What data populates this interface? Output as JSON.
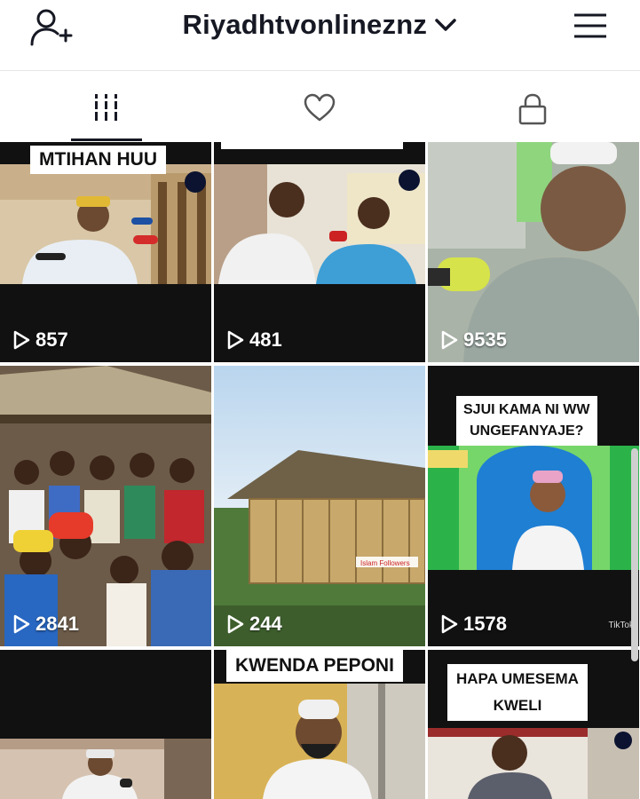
{
  "header": {
    "username": "Riyadhtvonlineznz",
    "add_user_icon": "add-user-icon",
    "dropdown_icon": "chevron-down-icon",
    "menu_icon": "hamburger-menu-icon"
  },
  "tabs": [
    {
      "name": "videos",
      "icon": "grid-icon",
      "active": true
    },
    {
      "name": "liked",
      "icon": "heart-icon",
      "active": false
    },
    {
      "name": "private",
      "icon": "lock-icon",
      "active": false
    }
  ],
  "videos": [
    {
      "caption": "MTIHAN HUU",
      "views": "857"
    },
    {
      "caption": "",
      "views": "481"
    },
    {
      "caption": "",
      "views": "9535"
    },
    {
      "caption": "",
      "views": "2841"
    },
    {
      "caption": "",
      "views": "244"
    },
    {
      "caption": "SJUI KAMA NI WW\nUNGEFANYAJE?",
      "views": "1578"
    },
    {
      "caption": "",
      "views": ""
    },
    {
      "caption": "KWENDA PEPONI",
      "views": ""
    },
    {
      "caption": "HAPA UMESEMA\nKWELI",
      "views": ""
    }
  ],
  "watermarks": {
    "tiktok": "TikTok",
    "overlay_small": "Islam Followers"
  },
  "colors": {
    "text": "#161823",
    "cell_dark": "#111111",
    "caption_bg": "#ffffff"
  }
}
